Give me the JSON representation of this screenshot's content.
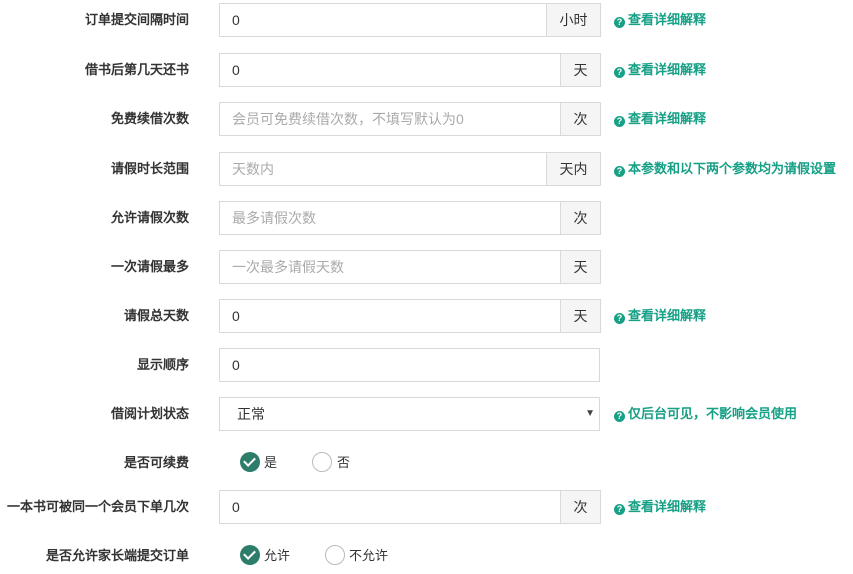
{
  "fields": [
    {
      "label": "订单提交间隔时间",
      "value": "0",
      "placeholder": "",
      "unit": "小时",
      "help": "查看详细解释"
    },
    {
      "label": "借书后第几天还书",
      "value": "0",
      "placeholder": "",
      "unit": "天",
      "help": "查看详细解释"
    },
    {
      "label": "免费续借次数",
      "value": "",
      "placeholder": "会员可免费续借次数，不填写默认为0",
      "unit": "次",
      "help": "查看详细解释"
    },
    {
      "label": "请假时长范围",
      "value": "",
      "placeholder": "天数内",
      "unit": "天内",
      "help": "本参数和以下两个参数均为请假设置"
    },
    {
      "label": "允许请假次数",
      "value": "",
      "placeholder": "最多请假次数",
      "unit": "次",
      "help": ""
    },
    {
      "label": "一次请假最多",
      "value": "",
      "placeholder": "一次最多请假天数",
      "unit": "天",
      "help": ""
    },
    {
      "label": "请假总天数",
      "value": "0",
      "placeholder": "",
      "unit": "天",
      "help": "查看详细解释"
    },
    {
      "label": "显示顺序",
      "value": "0",
      "placeholder": "",
      "unit": "",
      "help": ""
    }
  ],
  "status": {
    "label": "借阅计划状态",
    "selected": "正常",
    "help": "仅后台可见，不影响会员使用"
  },
  "renewable": {
    "label": "是否可续费",
    "options": [
      "是",
      "否"
    ],
    "selected": "是"
  },
  "limit": {
    "label": "一本书可被同一个会员下单几次",
    "value": "0",
    "unit": "次",
    "help": "查看详细解释"
  },
  "parent_order": {
    "label": "是否允许家长端提交订单",
    "options": [
      "允许",
      "不允许"
    ],
    "selected": "允许"
  },
  "colors": {
    "accent": "#16a085",
    "radio_checked": "#2e7d6b",
    "border": "#d9d9d9",
    "addon_bg": "#f5f5f5"
  }
}
